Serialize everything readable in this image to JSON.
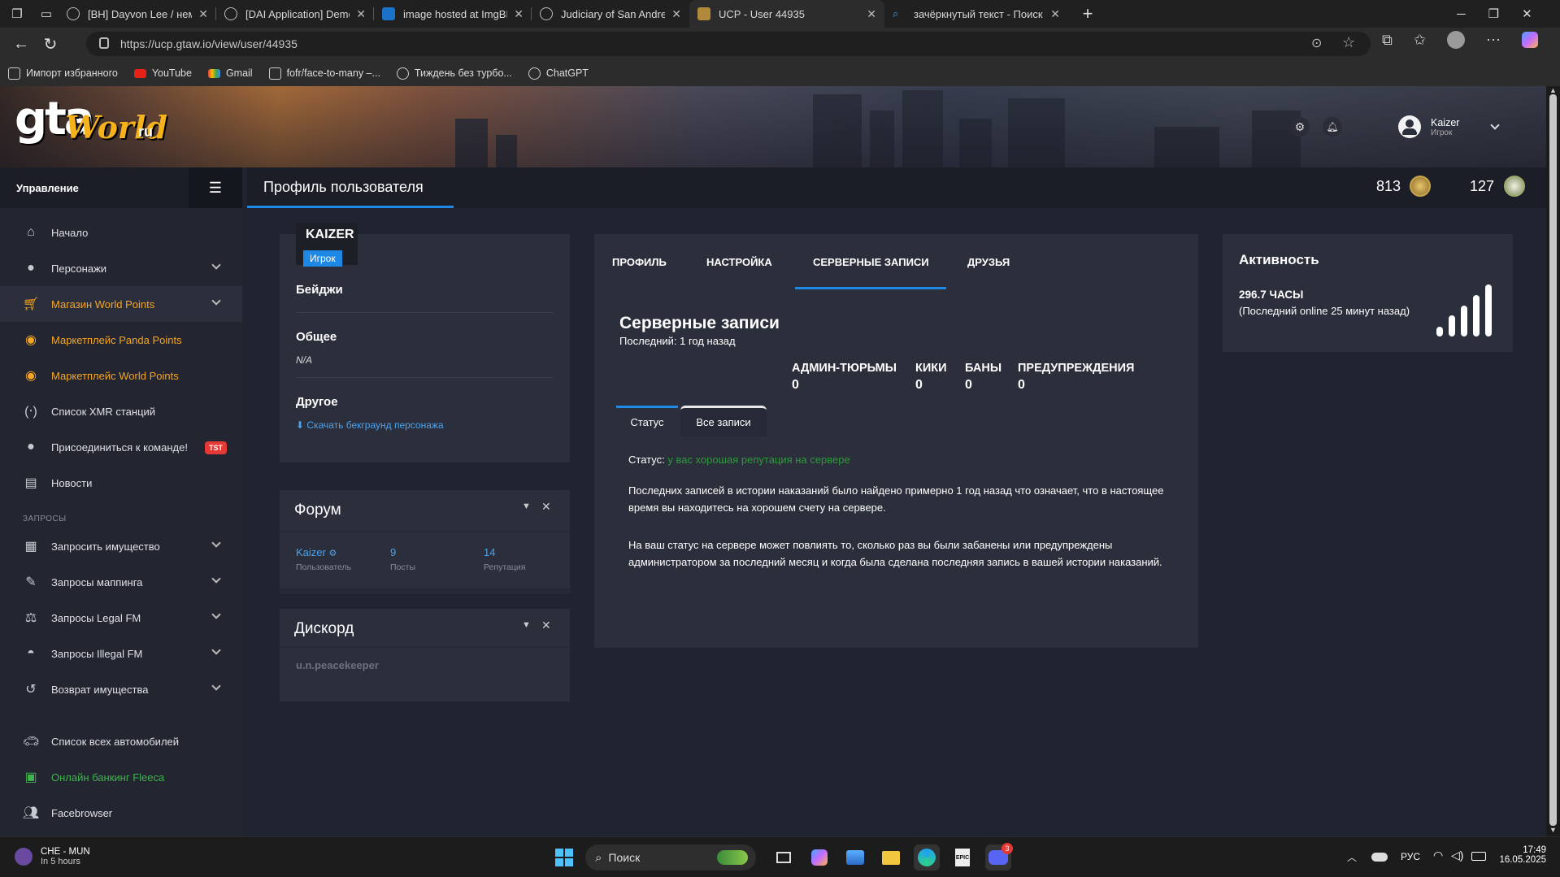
{
  "browser": {
    "tabs": [
      {
        "title": "[BH] Dayvon Lee / немец - Judici"
      },
      {
        "title": "[DAI Application] Demora Curie [A"
      },
      {
        "title": "image hosted at ImgBB — ImgBB"
      },
      {
        "title": "Judiciary of San Andreas - Новая"
      },
      {
        "title": "UCP - User 44935"
      },
      {
        "title": "зачёркнутый текст - Поиск"
      }
    ],
    "url": "https://ucp.gtaw.io/view/user/44935",
    "bookmarks": [
      "Импорт избранного",
      "YouTube",
      "Gmail",
      "fofr/face-to-many –...",
      "Тиждень без турбо...",
      "ChatGPT"
    ]
  },
  "header": {
    "logo_main": "gta",
    "logo_script": "World",
    "logo_suffix": "ru",
    "user_name": "Kaizer",
    "user_role": "Игрок"
  },
  "sidebar": {
    "title": "Управление",
    "items": [
      {
        "label": "Начало",
        "icon": "home-icon"
      },
      {
        "label": "Персонажи",
        "icon": "user-icon"
      },
      {
        "label": "Магазин World Points",
        "icon": "cart-icon"
      },
      {
        "label": "Маркетплейс Panda Points",
        "icon": "coins-icon"
      },
      {
        "label": "Маркетплейс World Points",
        "icon": "coins-icon"
      },
      {
        "label": "Список XMR станций",
        "icon": "antenna-icon"
      },
      {
        "label": "Присоединиться к команде!",
        "icon": "user-tie-icon",
        "badge": "TST"
      },
      {
        "label": "Новости",
        "icon": "newspaper-icon"
      }
    ],
    "section_requests": "ЗАПРОСЫ",
    "request_items": [
      {
        "label": "Запросить имущество",
        "icon": "building-icon"
      },
      {
        "label": "Запросы маппинга",
        "icon": "brush-icon"
      },
      {
        "label": "Запросы Legal FM",
        "icon": "scale-icon"
      },
      {
        "label": "Запросы Illegal FM",
        "icon": "mask-icon"
      },
      {
        "label": "Возврат имущества",
        "icon": "undo-icon"
      }
    ],
    "bottom_items": [
      {
        "label": "Список всех автомобилей",
        "icon": "car-icon"
      },
      {
        "label": "Онлайн банкинг Fleeca",
        "icon": "bank-icon"
      },
      {
        "label": "Facebrowser",
        "icon": "users-icon"
      }
    ]
  },
  "page_header": {
    "title": "Профиль пользователя",
    "world_points": "813",
    "panda_points": "127"
  },
  "profile": {
    "name": "KAIZER",
    "role": "Игрок",
    "badges_label": "Бейджи",
    "general_label": "Общее",
    "general_value": "N/A",
    "other_label": "Другое",
    "download_link": "Скачать бекграунд персонажа"
  },
  "forum": {
    "title": "Форум",
    "user": "Kaizer",
    "user_label": "Пользователь",
    "posts": "9",
    "posts_label": "Посты",
    "rep": "14",
    "rep_label": "Репутация"
  },
  "discord": {
    "title": "Дискорд",
    "user": "u.n.peacekeeper"
  },
  "tabs": [
    "ПРОФИЛЬ",
    "НАСТРОЙКА",
    "СЕРВЕРНЫЕ ЗАПИСИ",
    "ДРУЗЬЯ"
  ],
  "records": {
    "title": "Серверные записи",
    "last": "Последний: 1 год назад",
    "stats": [
      {
        "label": "АДМИН-ТЮРЬМЫ",
        "value": "0"
      },
      {
        "label": "КИКИ",
        "value": "0"
      },
      {
        "label": "БАНЫ",
        "value": "0"
      },
      {
        "label": "ПРЕДУПРЕЖДЕНИЯ",
        "value": "0"
      }
    ],
    "subtabs": [
      "Статус",
      "Все записи"
    ],
    "status_label": "Статус:",
    "status_value": "у вас хорошая репутация на сервере",
    "para1": "Последних записей в истории наказаний было найдено примерно 1 год назад что означает, что в настоящее время вы находитесь на хорошем счету на сервере.",
    "para2": "На ваш статус на сервере может повлиять то, сколько раз вы были забанены или предупреждены администратором за последний месяц и когда была сделана последняя запись в вашей истории наказаний."
  },
  "activity": {
    "title": "Активность",
    "hours": "296.7 ЧАСЫ",
    "last_online": "(Последний online 25 минут назад)"
  },
  "taskbar": {
    "weather_title": "CHE - MUN",
    "weather_sub": "In 5 hours",
    "search": "Поиск",
    "lang": "РУС",
    "time": "17:49",
    "date": "16.05.2025",
    "discord_badge": "3"
  },
  "colors": {
    "accent_blue": "#1e88e5",
    "orange": "#f5a623",
    "green": "#3fb34f",
    "bg": "#202330",
    "card": "#2b2e3b"
  }
}
